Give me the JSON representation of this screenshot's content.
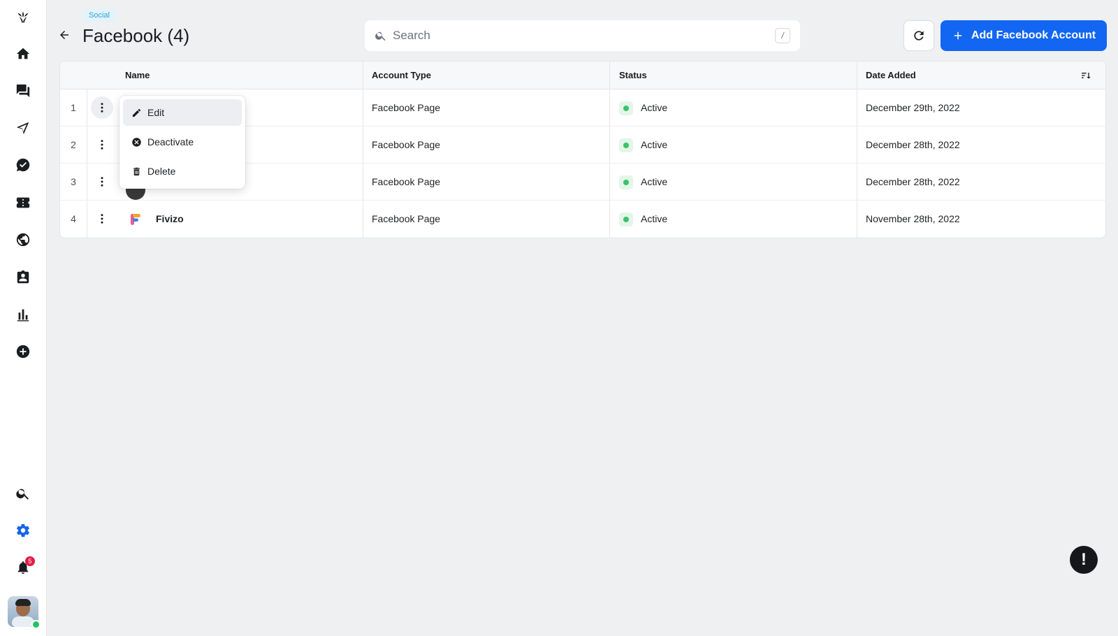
{
  "sidebar": {
    "notification_count": "5",
    "items": [
      {
        "name": "home"
      },
      {
        "name": "conversations"
      },
      {
        "name": "campaigns"
      },
      {
        "name": "tasks"
      },
      {
        "name": "tickets"
      },
      {
        "name": "web"
      },
      {
        "name": "contacts"
      },
      {
        "name": "reports"
      },
      {
        "name": "add"
      }
    ]
  },
  "header": {
    "tag": "Social",
    "title": "Facebook (4)",
    "search_placeholder": "Search",
    "search_shortcut": "/",
    "add_button_label": "Add Facebook Account"
  },
  "table": {
    "columns": [
      "Name",
      "Account Type",
      "Status",
      "Date Added"
    ],
    "rows": [
      {
        "num": "1",
        "name": "",
        "account_type": "Facebook Page",
        "status": "Active",
        "date_added": "December 29th, 2022"
      },
      {
        "num": "2",
        "name": "",
        "account_type": "Facebook Page",
        "status": "Active",
        "date_added": "December 28th, 2022"
      },
      {
        "num": "3",
        "name": "",
        "account_type": "Facebook Page",
        "status": "Active",
        "date_added": "December 28th, 2022"
      },
      {
        "num": "4",
        "name": "Fivizo",
        "account_type": "Facebook Page",
        "status": "Active",
        "date_added": "November 28th, 2022"
      }
    ]
  },
  "context_menu": {
    "items": [
      "Edit",
      "Deactivate",
      "Delete"
    ]
  },
  "colors": {
    "accent": "#1266f1",
    "status_active": "#3cc26a",
    "tag_text": "#2aa3d6"
  }
}
